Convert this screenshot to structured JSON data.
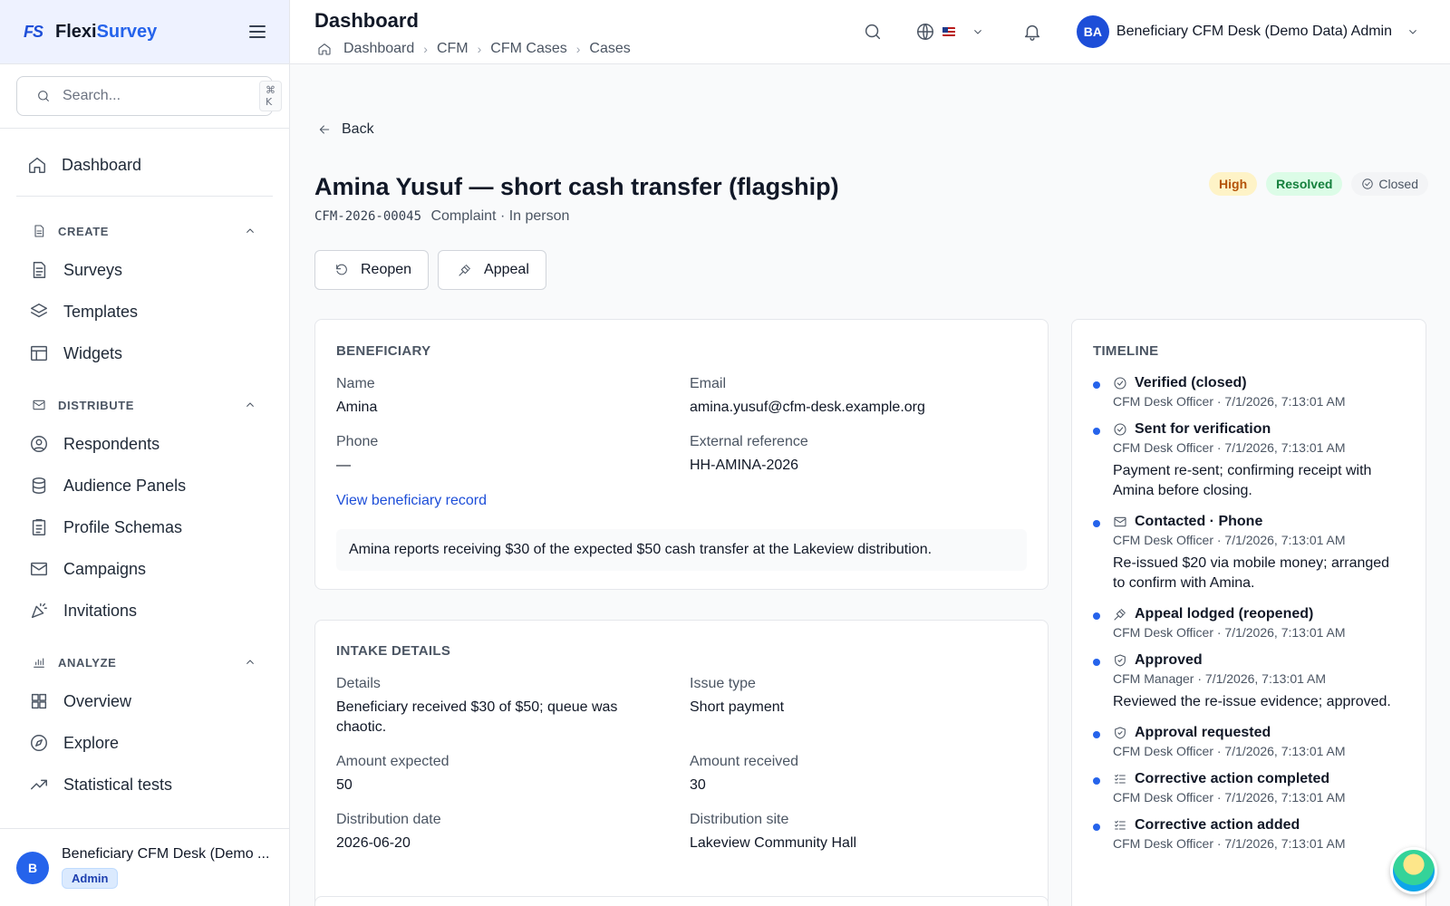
{
  "brand": {
    "logo": "FS",
    "name_first": "Flexi",
    "name_second": "Survey"
  },
  "search": {
    "placeholder": "Search...",
    "shortcut": "⌘ K"
  },
  "nav": {
    "dashboard": "Dashboard",
    "sections": {
      "create": {
        "label": "CREATE",
        "items": [
          "Surveys",
          "Templates",
          "Widgets"
        ]
      },
      "distribute": {
        "label": "DISTRIBUTE",
        "items": [
          "Respondents",
          "Audience Panels",
          "Profile Schemas",
          "Campaigns",
          "Invitations"
        ]
      },
      "analyze": {
        "label": "ANALYZE",
        "items": [
          "Overview",
          "Explore",
          "Statistical tests"
        ]
      }
    }
  },
  "sidebar_user": {
    "initial": "B",
    "name": "Beneficiary CFM Desk (Demo ...",
    "role": "Admin"
  },
  "header": {
    "title": "Dashboard",
    "breadcrumb": [
      "Dashboard",
      "CFM",
      "CFM Cases",
      "Cases"
    ],
    "user_initials": "BA",
    "user_name": "Beneficiary CFM Desk (Demo Data) Admin"
  },
  "case": {
    "back_label": "Back",
    "title": "Amina Yusuf — short cash transfer (flagship)",
    "id": "CFM-2026-00045",
    "subtitle": "Complaint · In person",
    "badges": {
      "priority": "High",
      "status": "Resolved",
      "state": "Closed"
    },
    "actions": {
      "reopen": "Reopen",
      "appeal": "Appeal"
    }
  },
  "beneficiary": {
    "heading": "BENEFICIARY",
    "name_label": "Name",
    "name": "Amina",
    "email_label": "Email",
    "email": "amina.yusuf@cfm-desk.example.org",
    "phone_label": "Phone",
    "phone": "—",
    "extref_label": "External reference",
    "extref": "HH-AMINA-2026",
    "view_link": "View beneficiary record",
    "note": "Amina reports receiving $30 of the expected $50 cash transfer at the Lakeview distribution."
  },
  "intake": {
    "heading": "INTAKE DETAILS",
    "details_label": "Details",
    "details": "Beneficiary received $30 of $50; queue was chaotic.",
    "issue_label": "Issue type",
    "issue": "Short payment",
    "expected_label": "Amount expected",
    "expected": "50",
    "received_label": "Amount received",
    "received": "30",
    "date_label": "Distribution date",
    "date": "2026-06-20",
    "site_label": "Distribution site",
    "site": "Lakeview Community Hall"
  },
  "timeline": {
    "heading": "TIMELINE",
    "items": [
      {
        "icon": "check-circle-icon",
        "title": "Verified (closed)",
        "meta": "CFM Desk Officer · 7/1/2026, 7:13:01 AM",
        "note": ""
      },
      {
        "icon": "check-circle-icon",
        "title": "Sent for verification",
        "meta": "CFM Desk Officer · 7/1/2026, 7:13:01 AM",
        "note": "Payment re-sent; confirming receipt with Amina before closing."
      },
      {
        "icon": "mail-icon",
        "title": "Contacted · Phone",
        "meta": "CFM Desk Officer · 7/1/2026, 7:13:01 AM",
        "note": "Re-issued $20 via mobile money; arranged to confirm with Amina."
      },
      {
        "icon": "gavel-icon",
        "title": "Appeal lodged (reopened)",
        "meta": "CFM Desk Officer · 7/1/2026, 7:13:01 AM",
        "note": ""
      },
      {
        "icon": "shield-check-icon",
        "title": "Approved",
        "meta": "CFM Manager · 7/1/2026, 7:13:01 AM",
        "note": "Reviewed the re-issue evidence; approved."
      },
      {
        "icon": "shield-icon",
        "title": "Approval requested",
        "meta": "CFM Desk Officer · 7/1/2026, 7:13:01 AM",
        "note": ""
      },
      {
        "icon": "list-check-icon",
        "title": "Corrective action completed",
        "meta": "CFM Desk Officer · 7/1/2026, 7:13:01 AM",
        "note": ""
      },
      {
        "icon": "list-check-icon",
        "title": "Corrective action added",
        "meta": "CFM Desk Officer · 7/1/2026, 7:13:01 AM",
        "note": ""
      }
    ]
  },
  "colors": {
    "accent": "#2563eb",
    "high": "#b45309",
    "resolved": "#15803d"
  }
}
